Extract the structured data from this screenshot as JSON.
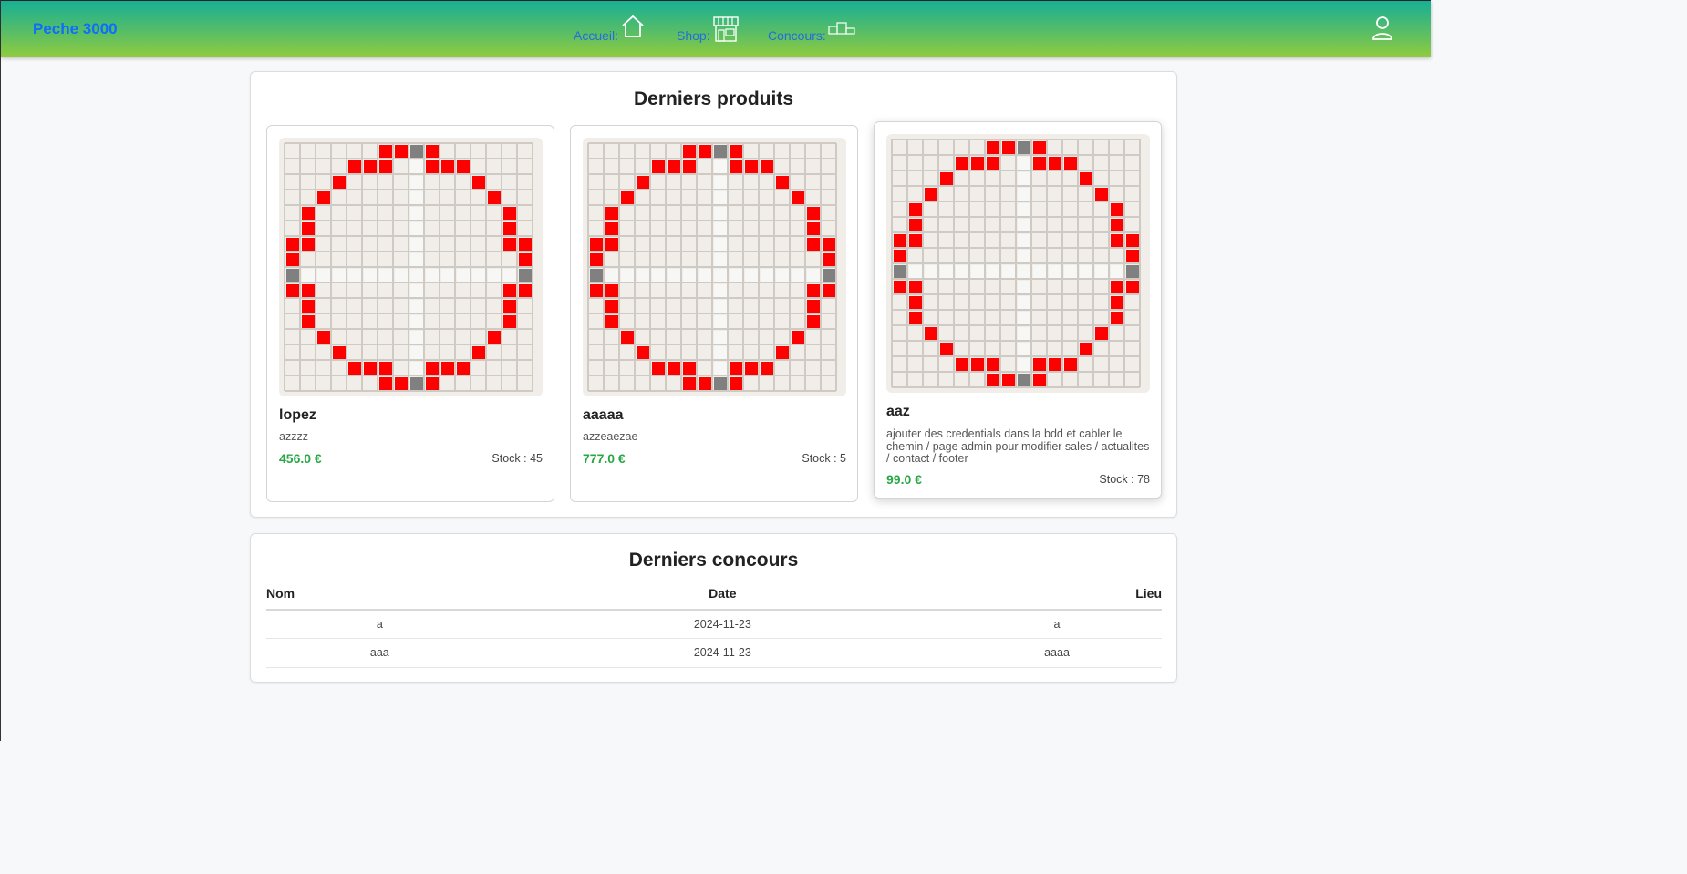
{
  "header": {
    "brand": "Peche 3000",
    "nav": [
      {
        "label": "Accueil:",
        "icon": "home-icon"
      },
      {
        "label": "Shop:",
        "icon": "shop-icon"
      },
      {
        "label": "Concours:",
        "icon": "podium-icon"
      }
    ],
    "user_icon": "user-icon"
  },
  "products_section": {
    "title": "Derniers produits",
    "items": [
      {
        "name": "lopez",
        "description": "azzzz",
        "price": "456.0 €",
        "stock": "Stock : 45"
      },
      {
        "name": "aaaaa",
        "description": "azzeaezae",
        "price": "777.0 €",
        "stock": "Stock : 5"
      },
      {
        "name": "aaz",
        "description": "ajouter des credentials dans la bdd et cabler le chemin / page admin pour modifier sales / actualites / contact / footer",
        "price": "99.0 €",
        "stock": "Stock : 78"
      }
    ]
  },
  "contests_section": {
    "title": "Derniers concours",
    "columns": [
      "Nom",
      "Date",
      "Lieu"
    ],
    "rows": [
      [
        "a",
        "2024-11-23",
        "a"
      ],
      [
        "aaa",
        "2024-11-23",
        "aaaa"
      ]
    ]
  },
  "colors": {
    "brand": "#0d6efd",
    "price": "#28a745",
    "pixel_red": "#ff0000",
    "pixel_grey": "#808080"
  }
}
